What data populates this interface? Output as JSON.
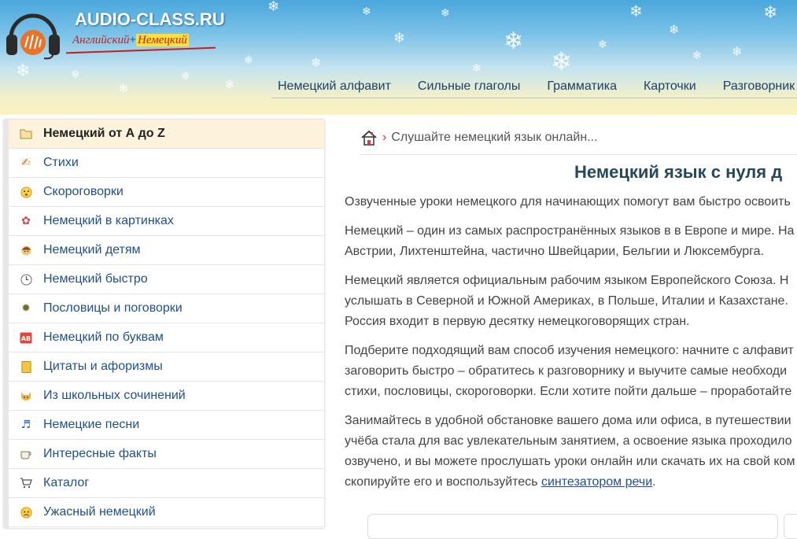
{
  "site": {
    "title": "AUDIO-CLASS.RU",
    "subtitle_left": "Английский",
    "subtitle_plus": "+",
    "subtitle_right": "Немецкий"
  },
  "topnav": [
    "Немецкий алфавит",
    "Сильные глаголы",
    "Грамматика",
    "Карточки",
    "Разговорник"
  ],
  "sidebar": {
    "items": [
      {
        "label": "Немецкий от А до Z",
        "icon": "folder-icon",
        "active": true
      },
      {
        "label": "Стихи",
        "icon": "pen-icon"
      },
      {
        "label": "Скороговорки",
        "icon": "face-icon"
      },
      {
        "label": "Немецкий в картинках",
        "icon": "flower-icon"
      },
      {
        "label": "Немецкий детям",
        "icon": "child-icon"
      },
      {
        "label": "Немецкий быстро",
        "icon": "clock-icon"
      },
      {
        "label": "Пословицы и поговорки",
        "icon": "gear-icon"
      },
      {
        "label": "Немецкий по буквам",
        "icon": "ab-icon"
      },
      {
        "label": "Цитаты и афоризмы",
        "icon": "notebook-icon"
      },
      {
        "label": "Из школьных сочинений",
        "icon": "cat-icon"
      },
      {
        "label": "Немецкие песни",
        "icon": "music-icon"
      },
      {
        "label": "Интересные факты",
        "icon": "cup-icon"
      },
      {
        "label": "Каталог",
        "icon": "cart-icon"
      },
      {
        "label": "Ужасный немецкий",
        "icon": "angry-face-icon"
      }
    ]
  },
  "breadcrumb": {
    "home_icon": "home-icon",
    "separator": "›",
    "current": "Слушайте немецкий язык онлайн..."
  },
  "main": {
    "title": "Немецкий язык с нуля д",
    "paragraphs": [
      [
        "Озвученные уроки немецкого для начинающих помогут вам быстро освоить"
      ],
      [
        "Немецкий – один из самых распространённых языков в в Европе и мире. На",
        "Австрии, Лихтенштейна, частично Швейцарии, Бельгии и Люксембурга."
      ],
      [
        "Немецкий является официальным рабочим языком Европейского Союза. Н",
        "услышать в Северной и Южной Америках, в Польше, Италии и Казахстане.",
        "Россия входит в первую десятку немецкоговорящих стран."
      ],
      [
        "Подберите подходящий вам способ изучения немецкого: начните с алфавит",
        "заговорить быстро – обратитесь к разговорнику и выучите самые необходи",
        "стихи, пословицы, скороговорки. Если хотите пойти дальше – проработайте"
      ],
      [
        "Занимайтесь в удобной обстановке вашего дома или офиса, в путешествии",
        "учёба стала для вас увлекательным занятием, а освоение языка проходило",
        "озвучено, и вы можете прослушать уроки онлайн или скачать их на свой ком"
      ]
    ],
    "last_line_prefix": "скопируйте его и воспользуйтесь ",
    "last_line_link": "синтезатором речи",
    "last_line_suffix": "."
  }
}
